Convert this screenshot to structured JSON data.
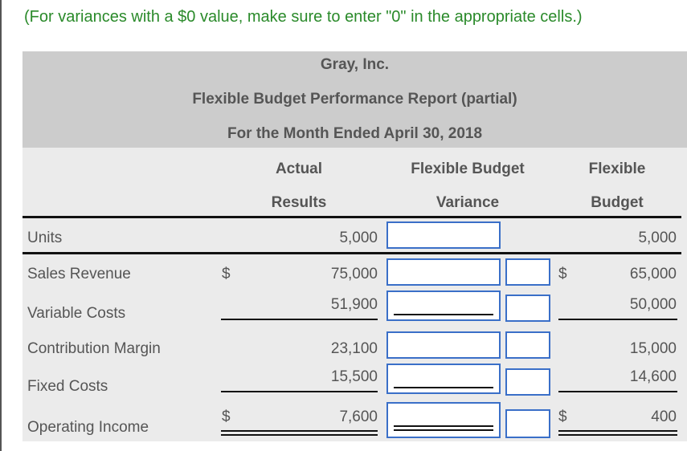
{
  "instruction": "(For variances with a $0 value, make sure to enter \"0\" in the appropriate cells.)",
  "header": {
    "company": "Gray, Inc.",
    "title": "Flexible Budget Performance Report (partial)",
    "period": "For the Month Ended April 30, 2018"
  },
  "columns": {
    "actual": [
      "Actual",
      "Results"
    ],
    "variance": [
      "Flexible Budget",
      "Variance"
    ],
    "flexible": [
      "Flexible",
      "Budget"
    ]
  },
  "rows": [
    {
      "label": "Units",
      "actual": "5,000",
      "flexible": "5,000",
      "actual_dollar": "",
      "flexible_dollar": "",
      "variance_value": "",
      "fu_value": ""
    },
    {
      "label": "Sales Revenue",
      "actual": "75,000",
      "flexible": "65,000",
      "actual_dollar": "$",
      "flexible_dollar": "$",
      "variance_value": "",
      "fu_value": ""
    },
    {
      "label": "Variable Costs",
      "actual": "51,900",
      "flexible": "50,000",
      "actual_dollar": "",
      "flexible_dollar": "",
      "variance_value": "",
      "fu_value": ""
    },
    {
      "label": "Contribution Margin",
      "actual": "23,100",
      "flexible": "15,000",
      "actual_dollar": "",
      "flexible_dollar": "",
      "variance_value": "",
      "fu_value": ""
    },
    {
      "label": "Fixed Costs",
      "actual": "15,500",
      "flexible": "14,600",
      "actual_dollar": "",
      "flexible_dollar": "",
      "variance_value": "",
      "fu_value": ""
    },
    {
      "label": "Operating Income",
      "actual": "7,600",
      "flexible": "400",
      "actual_dollar": "$",
      "flexible_dollar": "$",
      "variance_value": "",
      "fu_value": ""
    }
  ],
  "colors": {
    "instruction": "#2a8a2a",
    "header_band": "#cccccc",
    "table_bg": "#ebebeb",
    "input_border": "#3a6fc8"
  }
}
